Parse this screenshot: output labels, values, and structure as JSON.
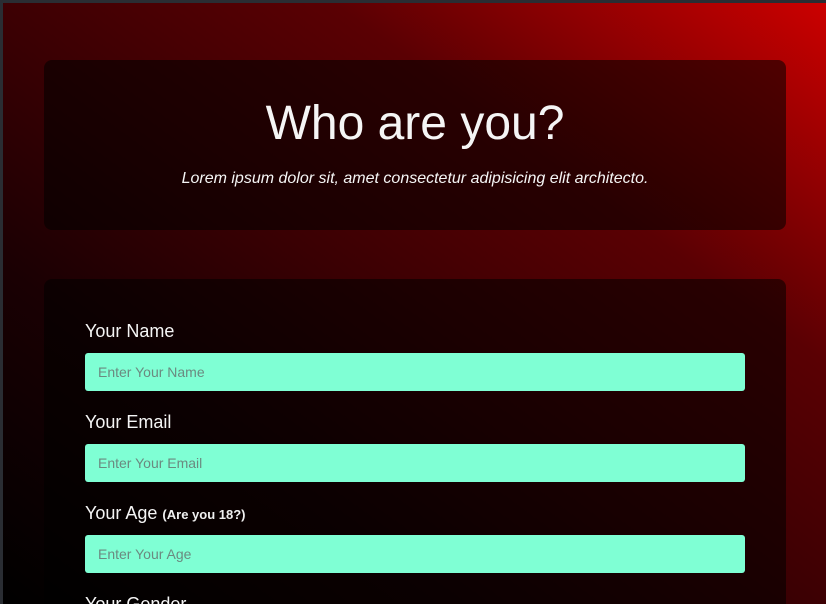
{
  "header": {
    "title": "Who are you?",
    "subtitle": "Lorem ipsum dolor sit, amet consectetur adipisicing elit architecto."
  },
  "form": {
    "name": {
      "label": "Your Name",
      "placeholder": "Enter Your Name"
    },
    "email": {
      "label": "Your Email",
      "placeholder": "Enter Your Email"
    },
    "age": {
      "label": "Your Age",
      "hint": "(Are you 18?)",
      "placeholder": "Enter Your Age"
    },
    "gender": {
      "label": "Your Gender"
    }
  },
  "colors": {
    "input_bg": "#7fffd4",
    "gradient_accent": "#cc0000"
  }
}
